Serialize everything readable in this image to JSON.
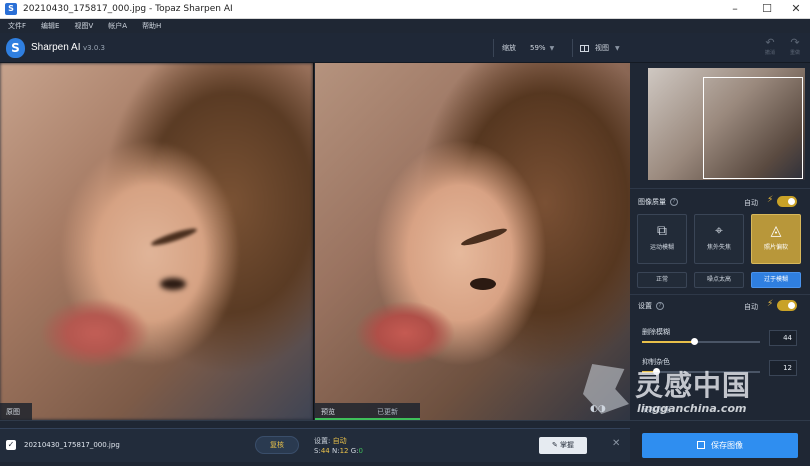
{
  "window": {
    "title": "20210430_175817_000.jpg - Topaz Sharpen AI",
    "controls": {
      "minimize": "–",
      "maximize": "☐",
      "close": "✕"
    }
  },
  "menu": [
    "文件F",
    "编辑E",
    "视图V",
    "帐户A",
    "帮助H"
  ],
  "header": {
    "app_name": "Sharpen AI",
    "version": "v3.0.3",
    "zoom_label": "缩放",
    "zoom_value": "59%",
    "view_label": "视图",
    "undo_label": "撤消",
    "redo_label": "重做"
  },
  "panes": {
    "left_tag": "原图",
    "right_tag": "预览",
    "right_status": "已更新"
  },
  "panel": {
    "quality_title": "图像质量",
    "auto_label": "自动",
    "modes": [
      {
        "label": "运动模糊",
        "icon": "camera-motion-icon"
      },
      {
        "label": "焦外失焦",
        "icon": "focus-icon"
      },
      {
        "label": "照片偏软",
        "icon": "drop-icon"
      }
    ],
    "active_mode": 2,
    "submodes": [
      "正常",
      "噪点太高",
      "过于模糊"
    ],
    "active_submode": 2,
    "settings_title": "设置",
    "settings_auto": "自动",
    "sliders": [
      {
        "label": "删除模糊",
        "value": "44",
        "level": 0.44
      },
      {
        "label": "抑制杂色",
        "value": "12",
        "level": 0.12
      }
    ],
    "partial_label": "局部处理"
  },
  "bottom": {
    "filename": "20210430_175817_000.jpg",
    "review_label": "复核",
    "settings_line_label": "设置:",
    "settings_line_value": "自动",
    "stats_s_label": "S:",
    "stats_s": "44",
    "stats_n_label": "N:",
    "stats_n": "12",
    "stats_g_label": "G:",
    "stats_g": "0",
    "hide_label": "掌握",
    "save_label": "保存图像"
  },
  "watermark": {
    "big": "灵感中国",
    "small": "lingganchina.com"
  },
  "colors": {
    "accent_blue": "#2f8ef0",
    "accent_gold": "#e8c04a",
    "status_green": "#3fbf5a"
  }
}
